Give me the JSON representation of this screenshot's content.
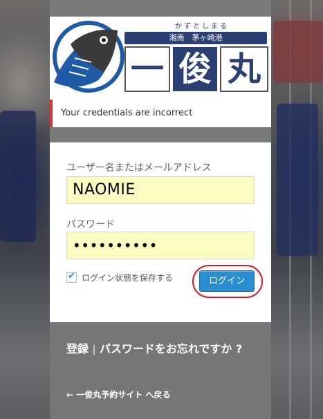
{
  "logo": {
    "reading": "かずとしまる",
    "subtitle": "湘南　茅ヶ崎港",
    "name_chars": [
      "一",
      "俊",
      "丸"
    ]
  },
  "error_message": "Your credentials are incorrect",
  "form": {
    "username_label": "ユーザー名またはメールアドレス",
    "username_value": "NAOMIE",
    "password_label": "パスワード",
    "password_value": "••••••••••",
    "remember_label": "ログイン状態を保存する",
    "remember_checked": true,
    "login_button": "ログイン"
  },
  "footer": {
    "register_link": "登録",
    "separator": "|",
    "lost_password_link": "パスワードをお忘れですか ?",
    "back_link": "← 一俊丸予約サイト へ戻る"
  },
  "colors": {
    "error_border": "#d0393b",
    "button": "#2a8dcf",
    "highlight_ring": "#d11a2a",
    "input_bg": "#fbfbc2"
  }
}
